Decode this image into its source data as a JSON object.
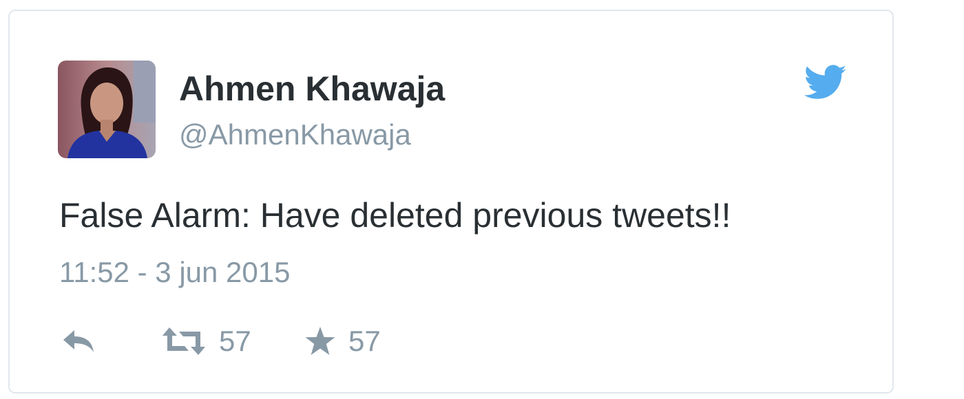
{
  "tweet": {
    "author": {
      "display_name": "Ahmen Khawaja",
      "handle": "@AhmenKhawaja"
    },
    "text": "False Alarm: Have deleted previous tweets!!",
    "timestamp": "11:52 - 3 jun 2015",
    "actions": {
      "reply_icon": "reply-icon",
      "retweet_icon": "retweet-icon",
      "retweet_count": "57",
      "favorite_icon": "star-icon",
      "favorite_count": "57"
    }
  },
  "brand": {
    "logo_icon": "twitter-bird-icon",
    "accent_color": "#55acee"
  },
  "colors": {
    "text_primary": "#292f33",
    "text_secondary": "#8899a6",
    "border": "#e1e8ed"
  }
}
